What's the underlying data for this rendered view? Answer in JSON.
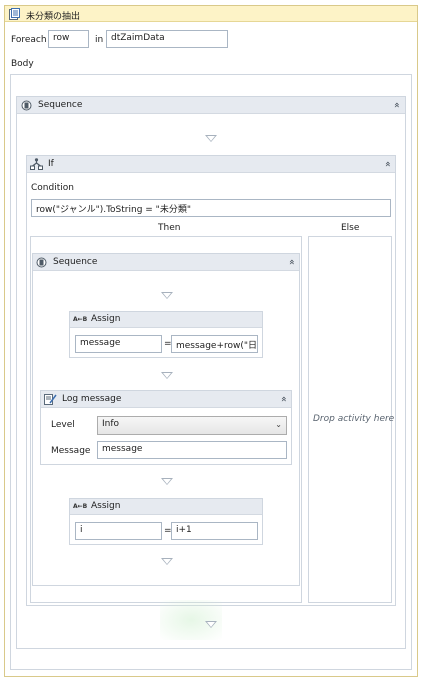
{
  "foreach": {
    "title": "未分類の抽出",
    "foreach_label": "Foreach",
    "item_var": "row",
    "in_label": "in",
    "collection": "dtZaimData",
    "body_label": "Body"
  },
  "sequence_outer": {
    "title": "Sequence",
    "collapse_glyph": "«"
  },
  "if_block": {
    "title": "If",
    "collapse_glyph": "«",
    "condition_label": "Condition",
    "condition_value": "row(\"ジャンル\").ToString = \"未分類\"",
    "then_label": "Then",
    "else_label": "Else",
    "else_placeholder": "Drop activity here"
  },
  "sequence_inner": {
    "title": "Sequence",
    "collapse_glyph": "«"
  },
  "assign1": {
    "title": "Assign",
    "to": "message",
    "equals": "=",
    "value": "message+row(\"日付"
  },
  "log": {
    "title": "Log message",
    "collapse_glyph": "«",
    "level_label": "Level",
    "level_value": "Info",
    "message_label": "Message",
    "message_value": "message"
  },
  "assign2": {
    "title": "Assign",
    "to": "i",
    "equals": "=",
    "value": "i+1"
  },
  "colors": {
    "header_bg": "#e6eaf0",
    "foreach_header": "#fdf3c7",
    "border": "#cfd6df"
  }
}
